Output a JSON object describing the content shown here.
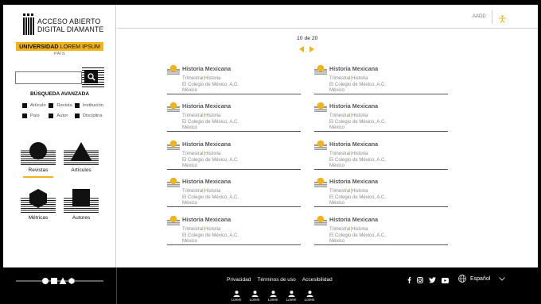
{
  "brand": {
    "title_line1": "ACCESO ABIERTO",
    "title_line2": "DIGITAL DIAMANTE",
    "university_bold": "UNIVERSIDAD",
    "university_light": "LOREM IPSUM",
    "country": "PAÍS"
  },
  "search": {
    "placeholder": "",
    "advanced_label": "BÚSQUEDA AVANZADA",
    "filters": [
      [
        "Artículo",
        "Revista",
        "Institución"
      ],
      [
        "País",
        "Autor",
        "Disciplina"
      ]
    ]
  },
  "nav": {
    "revistas": "Revistas",
    "articulos": "Artículos",
    "metricas": "Métricas",
    "autores": "Autores"
  },
  "topbar": {
    "link": "AADD"
  },
  "pager": {
    "label": "10 de 20"
  },
  "results": [
    {
      "title": "Historia Mexicana",
      "periodicity": "Trimestral",
      "subject": "Historia",
      "publisher": "El Colegio de México, A.C.",
      "country": "México"
    },
    {
      "title": "Historia Mexicana",
      "periodicity": "Trimestral",
      "subject": "Historia",
      "publisher": "El Colegio de México, A.C.",
      "country": "México"
    },
    {
      "title": "Historia Mexicana",
      "periodicity": "Trimestral",
      "subject": "Historia",
      "publisher": "El Colegio de México, A.C.",
      "country": "México"
    },
    {
      "title": "Historia Mexicana",
      "periodicity": "Trimestral",
      "subject": "Historia",
      "publisher": "El Colegio de México, A.C.",
      "country": "México"
    },
    {
      "title": "Historia Mexicana",
      "periodicity": "Trimestral",
      "subject": "Historia",
      "publisher": "El Colegio de México, A.C.",
      "country": "México"
    },
    {
      "title": "Historia Mexicana",
      "periodicity": "Trimestral",
      "subject": "Historia",
      "publisher": "El Colegio de México, A.C.",
      "country": "México"
    },
    {
      "title": "Historia Mexicana",
      "periodicity": "Trimestral",
      "subject": "Historia",
      "publisher": "El Colegio de México, A.C.",
      "country": "México"
    },
    {
      "title": "Historia Mexicana",
      "periodicity": "Trimestral",
      "subject": "Historia",
      "publisher": "El Colegio de México, A.C.",
      "country": "México"
    },
    {
      "title": "Historia Mexicana",
      "periodicity": "Trimestral",
      "subject": "Historia",
      "publisher": "El Colegio de México, A.C.",
      "country": "México"
    },
    {
      "title": "Historia Mexicana",
      "periodicity": "Trimestral",
      "subject": "Historia",
      "publisher": "El Colegio de México, A.C.",
      "country": "México"
    }
  ],
  "footer": {
    "links": [
      "Privacidad",
      "Términos de uso",
      "Accesibilidad"
    ],
    "language": "Español",
    "people": [
      "Lorem",
      "Lorem",
      "Lorem",
      "Lorem",
      "Lorem"
    ]
  },
  "colors": {
    "accent": "#f0b41c",
    "ink": "#111111",
    "background": "#000000"
  }
}
